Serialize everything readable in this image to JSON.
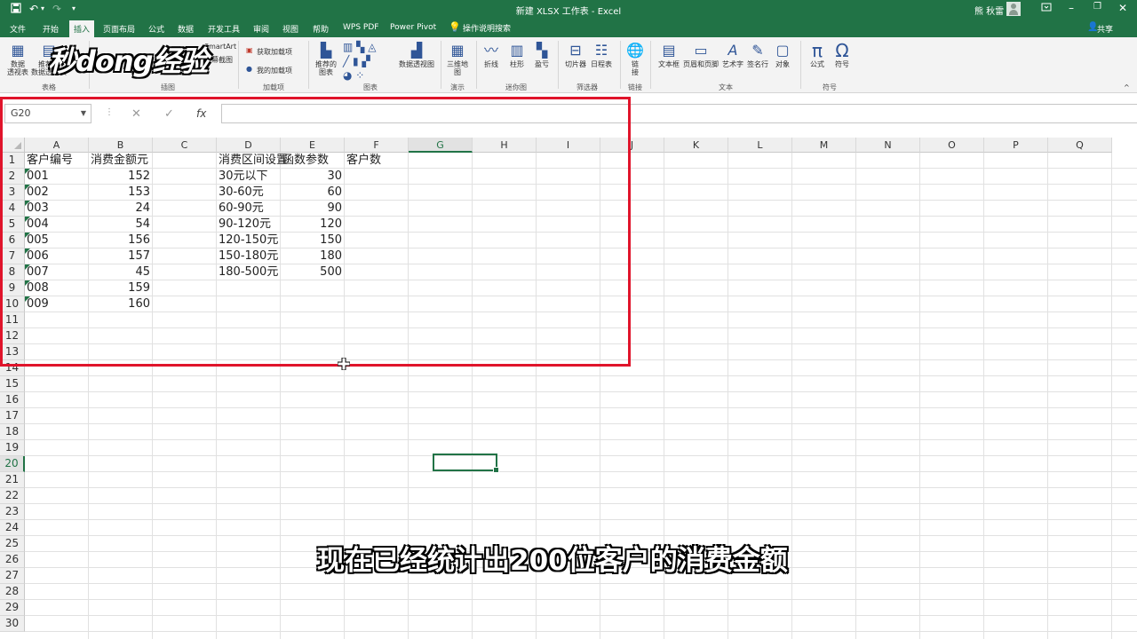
{
  "titlebar": {
    "title": "新建 XLSX 工作表 - Excel",
    "user": "熊 秋雷",
    "icons": [
      "save-icon",
      "undo-icon",
      "redo-icon",
      "customize-icon"
    ],
    "window_buttons": [
      "ribbon-display-icon",
      "minimize-icon",
      "restore-icon",
      "close-icon"
    ]
  },
  "tabs": [
    {
      "label": "文件",
      "active": false
    },
    {
      "label": "开始",
      "active": false
    },
    {
      "label": "插入",
      "active": true
    },
    {
      "label": "页面布局",
      "active": false
    },
    {
      "label": "公式",
      "active": false
    },
    {
      "label": "数据",
      "active": false
    },
    {
      "label": "开发工具",
      "active": false
    },
    {
      "label": "审阅",
      "active": false
    },
    {
      "label": "视图",
      "active": false
    },
    {
      "label": "帮助",
      "active": false
    },
    {
      "label": "WPS PDF",
      "active": false
    },
    {
      "label": "Power Pivot",
      "active": false
    }
  ],
  "tellme": "操作说明搜索",
  "share": "共享",
  "ribbon": {
    "tables": {
      "pivot": "数据\n透视表",
      "recommended_pivot": "推荐的\n数据透视表",
      "group": "表格"
    },
    "illustrations": {
      "smartart": "SmartArt",
      "screenshot": "屏幕截图",
      "group": "插图"
    },
    "addins": {
      "get": "获取加载项",
      "my": "我的加载项",
      "group": "加载项"
    },
    "charts": {
      "recommended": "推荐的\n图表",
      "pivotchart": "数据透视图",
      "group": "图表"
    },
    "tours": {
      "map3d": "三维地\n图",
      "group": "演示"
    },
    "sparklines": {
      "line": "折线",
      "column": "柱形",
      "winloss": "盈亏",
      "group": "迷你图"
    },
    "filters": {
      "slicer": "切片器",
      "timeline": "日程表",
      "group": "筛选器"
    },
    "links": {
      "link": "链\n接",
      "group": "链接"
    },
    "text": {
      "textbox": "文本框",
      "headerfooter": "页眉和页脚",
      "wordart": "艺术字",
      "signature": "签名行",
      "object": "对象",
      "group": "文本"
    },
    "symbols": {
      "equation": "公式",
      "symbol": "符号",
      "group": "符号"
    }
  },
  "watermark": "秒dong经验",
  "formula_bar": {
    "name_box": "G20",
    "formula": "",
    "fx": "fx"
  },
  "columns": [
    "A",
    "B",
    "C",
    "D",
    "E",
    "F",
    "G",
    "H",
    "I",
    "J",
    "K",
    "L",
    "M",
    "N",
    "O",
    "P",
    "Q"
  ],
  "selected_column": "G",
  "rows": [
    "1",
    "2",
    "3",
    "4",
    "5",
    "6",
    "7",
    "8",
    "9",
    "10",
    "11",
    "12",
    "13",
    "14",
    "15",
    "16",
    "17",
    "18",
    "19",
    "20",
    "21",
    "22",
    "23",
    "24",
    "25",
    "26",
    "27",
    "28",
    "29",
    "30"
  ],
  "selected_row": "20",
  "sheet": {
    "headers": {
      "A": "客户编号",
      "B": "消费金额元",
      "D": "消费区间设置",
      "E": "函数参数",
      "F": "客户数"
    },
    "customers": [
      {
        "id": "001",
        "amount": "152"
      },
      {
        "id": "002",
        "amount": "153"
      },
      {
        "id": "003",
        "amount": "24"
      },
      {
        "id": "004",
        "amount": "54"
      },
      {
        "id": "005",
        "amount": "156"
      },
      {
        "id": "006",
        "amount": "157"
      },
      {
        "id": "007",
        "amount": "45"
      },
      {
        "id": "008",
        "amount": "159"
      },
      {
        "id": "009",
        "amount": "160"
      }
    ],
    "ranges": [
      {
        "label": "30元以下",
        "param": "30"
      },
      {
        "label": "30-60元",
        "param": "60"
      },
      {
        "label": "60-90元",
        "param": "90"
      },
      {
        "label": "90-120元",
        "param": "120"
      },
      {
        "label": "120-150元",
        "param": "150"
      },
      {
        "label": "150-180元",
        "param": "180"
      },
      {
        "label": "180-500元",
        "param": "500"
      }
    ]
  },
  "subtitle": "现在已经统计出200位客户的消费金额",
  "colors": {
    "excel_green": "#217346",
    "highlight_red": "#e0142b"
  }
}
